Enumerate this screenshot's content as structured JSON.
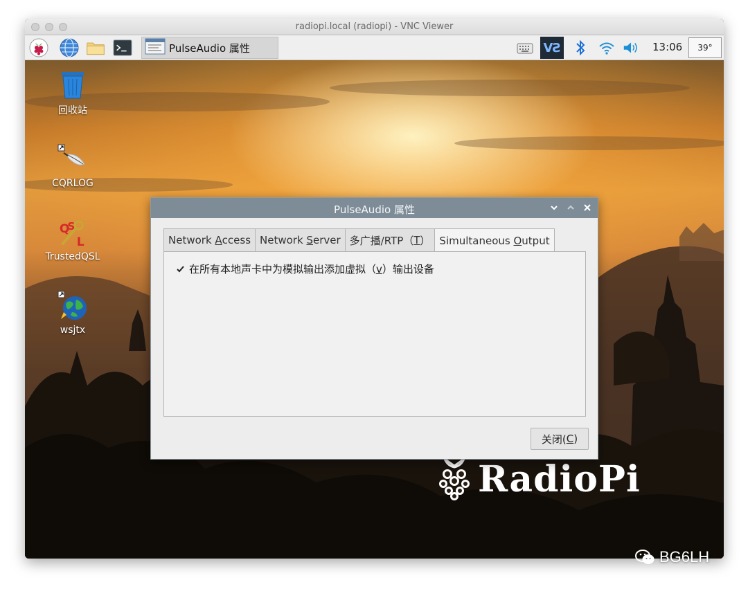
{
  "window": {
    "title": "radiopi.local (radiopi) - VNC Viewer"
  },
  "taskbar": {
    "launchers": [
      "raspberry-menu-icon",
      "web-browser-icon",
      "file-manager-icon",
      "terminal-icon"
    ],
    "task_button": {
      "label": "PulseAudio 属性",
      "icon": "pavucontrol-icon"
    },
    "tray": {
      "vnc_label": "VƧ",
      "clock": "13:06",
      "temperature": "39°"
    }
  },
  "desktop": {
    "icons": [
      {
        "label": "回收站",
        "icon": "trash-icon"
      },
      {
        "label": "CQRLOG",
        "icon": "cqrlog-icon"
      },
      {
        "label": "TrustedQSL",
        "icon": "trustedqsl-icon"
      },
      {
        "label": "wsjtx",
        "icon": "globe-icon"
      }
    ],
    "brand": "RadioPi"
  },
  "dialog": {
    "title": "PulseAudio 属性",
    "tabs": [
      {
        "prefix": "Network ",
        "mnemonic": "A",
        "suffix": "ccess"
      },
      {
        "prefix": "Network ",
        "mnemonic": "S",
        "suffix": "erver"
      },
      {
        "prefix": "多广播/RTP（",
        "mnemonic": "T",
        "suffix": "）"
      },
      {
        "prefix": "Simultaneous ",
        "mnemonic": "O",
        "suffix": "utput"
      }
    ],
    "active_tab": 3,
    "checkbox": {
      "checked": true,
      "label_before": "在所有本地声卡中为模拟输出添加虚拟（",
      "mnemonic": "v",
      "label_after": "）输出设备"
    },
    "close_button": {
      "label_before": "关闭(",
      "mnemonic": "C",
      "label_after": ")"
    }
  },
  "watermark": {
    "text": "BG6LH"
  },
  "colors": {
    "dialog_title_bar": "#7d8c97",
    "sunset_orange": "#e39a3c"
  }
}
